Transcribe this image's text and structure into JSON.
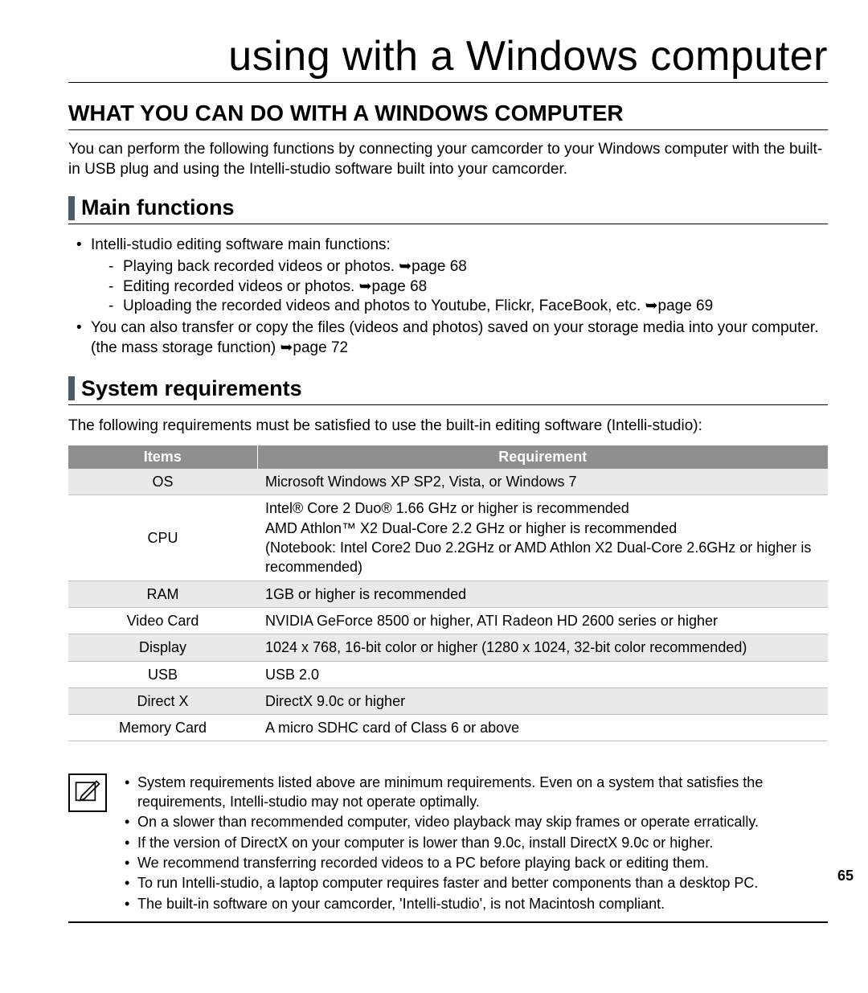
{
  "title": "using with a Windows computer",
  "section_head": "WHAT YOU CAN DO WITH A WINDOWS COMPUTER",
  "intro": "You can perform the following functions by connecting your camcorder to your Windows computer with the built-in USB plug and using the Intelli-studio software built into your camcorder.",
  "sub1": "Main functions",
  "mf_intro": "Intelli-studio editing software main functions:",
  "mf_items": [
    "Playing back recorded videos or photos. ➥page 68",
    "Editing recorded videos or photos. ➥page 68",
    "Uploading the recorded videos and photos to Youtube, Flickr, FaceBook, etc. ➥page 69"
  ],
  "mf_extra": "You can also transfer or copy the files (videos and photos) saved on your storage media into your computer. (the mass storage function) ➥page 72",
  "sub2": "System requirements",
  "sr_intro": "The following requirements must be satisfied to use the built-in editing software (Intelli-studio):",
  "table": {
    "headers": [
      "Items",
      "Requirement"
    ],
    "rows": [
      {
        "item": "OS",
        "req": "Microsoft Windows XP SP2, Vista, or Windows 7"
      },
      {
        "item": "CPU",
        "req": "Intel® Core 2 Duo® 1.66 GHz or higher is recommended\nAMD Athlon™ X2 Dual-Core 2.2 GHz or higher is recommended\n(Notebook: Intel Core2 Duo 2.2GHz or AMD Athlon X2 Dual-Core 2.6GHz or higher is recommended)"
      },
      {
        "item": "RAM",
        "req": "1GB or higher is recommended"
      },
      {
        "item": "Video Card",
        "req": "NVIDIA GeForce 8500 or higher, ATI Radeon HD 2600 series or higher"
      },
      {
        "item": "Display",
        "req": "1024 x 768, 16-bit color or higher (1280 x 1024, 32-bit color recommended)"
      },
      {
        "item": "USB",
        "req": "USB 2.0"
      },
      {
        "item": "Direct X",
        "req": "DirectX 9.0c or higher"
      },
      {
        "item": "Memory Card",
        "req": "A micro SDHC card of Class 6 or above"
      }
    ]
  },
  "notes": [
    "System requirements listed above are minimum requirements. Even on a system that satisfies the requirements, Intelli-studio may not operate optimally.",
    "On a slower than recommended computer, video playback may skip frames or operate erratically.",
    "If the version of DirectX on your computer is lower than 9.0c, install DirectX 9.0c or higher.",
    "We recommend transferring recorded videos to a PC before playing back or editing them.",
    "To run Intelli-studio, a laptop computer requires faster and better components than a desktop PC.",
    "The built-in software on your camcorder, 'Intelli-studio', is not Macintosh compliant."
  ],
  "page_number": "65"
}
